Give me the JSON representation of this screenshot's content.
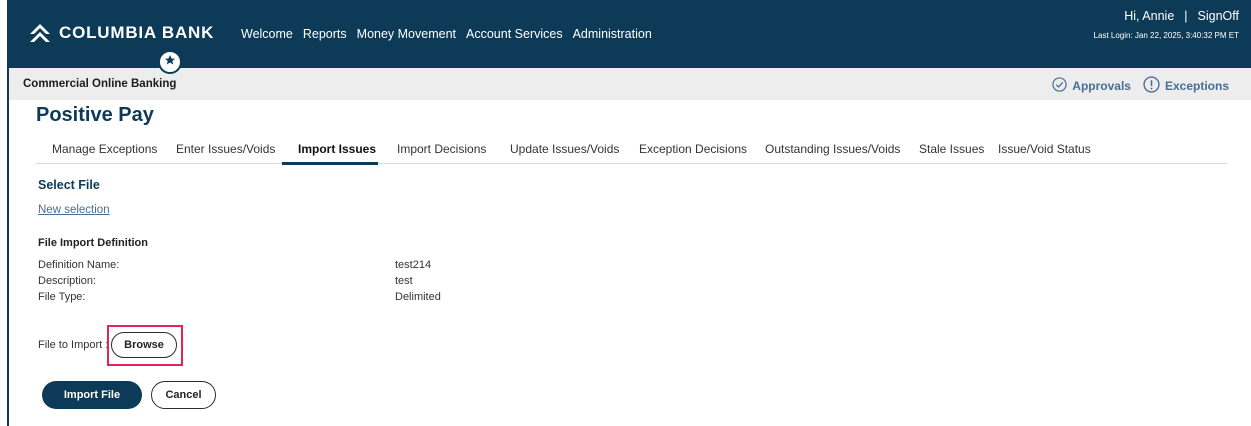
{
  "header": {
    "brand": "COLUMBIA BANK",
    "nav": [
      "Welcome",
      "Reports",
      "Money Movement",
      "Account Services",
      "Administration"
    ],
    "greeting": "Hi, Annie",
    "separator": "|",
    "signoff": "SignOff",
    "last_login": "Last Login: Jan 22, 2025, 3:40:32 PM ET"
  },
  "subbar": {
    "title": "Commercial Online Banking",
    "approvals": "Approvals",
    "exceptions": "Exceptions"
  },
  "page": {
    "title": "Positive Pay"
  },
  "tabs": [
    {
      "label": "Manage Exceptions",
      "active": false
    },
    {
      "label": "Enter Issues/Voids",
      "active": false
    },
    {
      "label": "Import Issues",
      "active": true
    },
    {
      "label": "Import Decisions",
      "active": false
    },
    {
      "label": "Update Issues/Voids",
      "active": false
    },
    {
      "label": "Exception Decisions",
      "active": false
    },
    {
      "label": "Outstanding Issues/Voids",
      "active": false
    },
    {
      "label": "Stale Issues",
      "active": false
    },
    {
      "label": "Issue/Void Status",
      "active": false
    }
  ],
  "select_file": {
    "title": "Select File",
    "new_selection": "New selection"
  },
  "definition": {
    "title": "File Import Definition",
    "rows": [
      {
        "label": "Definition Name:",
        "value": "test214"
      },
      {
        "label": "Description:",
        "value": "test"
      },
      {
        "label": "File Type:",
        "value": "Delimited"
      }
    ]
  },
  "file_import": {
    "label": "File to Import :",
    "browse": "Browse"
  },
  "actions": {
    "import": "Import File",
    "cancel": "Cancel"
  },
  "colors": {
    "brand_navy": "#0c3a57",
    "link_blue": "#4a6e93",
    "highlight": "#e0245e"
  },
  "icons": [
    "logo-mark-icon",
    "star-icon",
    "check-circle-icon",
    "exclamation-circle-icon"
  ]
}
